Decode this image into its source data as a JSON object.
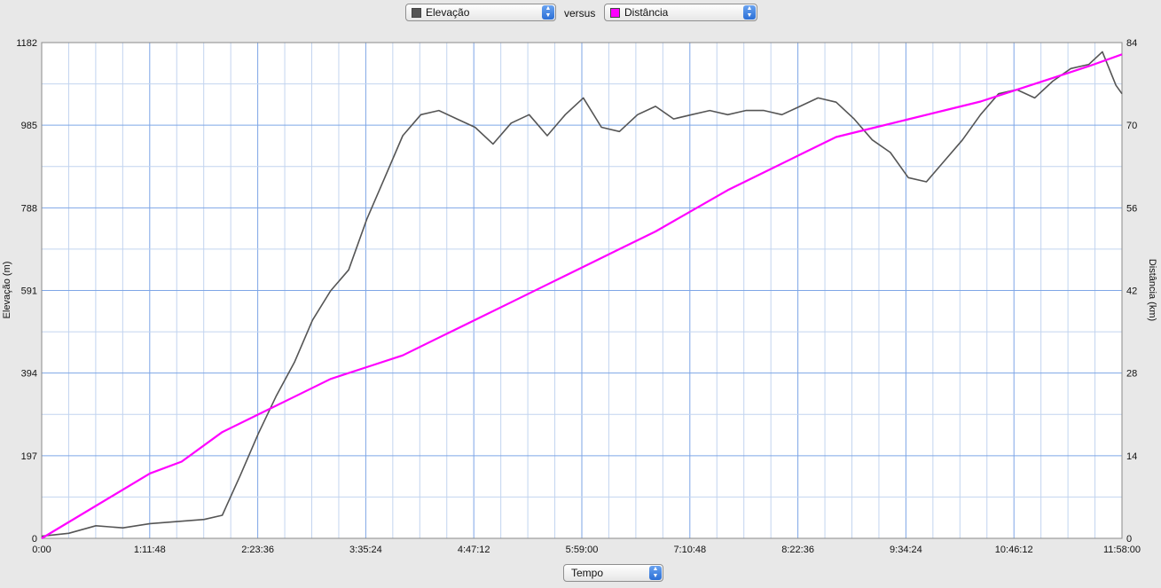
{
  "controls": {
    "series1_select": {
      "value": "Elevação",
      "color": "#555555"
    },
    "versus_label": "versus",
    "series2_select": {
      "value": "Distância",
      "color": "#ff00ff"
    },
    "xaxis_select": {
      "value": "Tempo"
    }
  },
  "chart_data": {
    "type": "line",
    "title": "",
    "xlabel": "Tempo",
    "ylabel_left": "Elevação (m)",
    "ylabel_right": "Distância (km)",
    "x_range_hours": [
      0,
      11.9667
    ],
    "x_tick_labels": [
      "0:00",
      "1:11:48",
      "2:23:36",
      "3:35:24",
      "4:47:12",
      "5:59:00",
      "7:10:48",
      "8:22:36",
      "9:34:24",
      "10:46:12",
      "11:58:00"
    ],
    "y_left_ticks": [
      "0",
      "197",
      "394",
      "591",
      "788",
      "985",
      "1182"
    ],
    "y_left_range": [
      0,
      1182
    ],
    "y_right_ticks": [
      "0",
      "14",
      "28",
      "42",
      "56",
      "70",
      "84"
    ],
    "y_right_range": [
      0,
      84
    ],
    "grid": true,
    "series": [
      {
        "name": "Elevação",
        "axis": "left",
        "color": "#555555",
        "points": [
          [
            0,
            5
          ],
          [
            0.3,
            12
          ],
          [
            0.6,
            30
          ],
          [
            0.9,
            25
          ],
          [
            1.2,
            35
          ],
          [
            1.5,
            40
          ],
          [
            1.8,
            45
          ],
          [
            2.0,
            55
          ],
          [
            2.2,
            150
          ],
          [
            2.4,
            250
          ],
          [
            2.6,
            340
          ],
          [
            2.8,
            420
          ],
          [
            3.0,
            520
          ],
          [
            3.2,
            590
          ],
          [
            3.4,
            640
          ],
          [
            3.6,
            760
          ],
          [
            3.8,
            860
          ],
          [
            4.0,
            960
          ],
          [
            4.2,
            1010
          ],
          [
            4.4,
            1020
          ],
          [
            4.6,
            1000
          ],
          [
            4.8,
            980
          ],
          [
            5.0,
            940
          ],
          [
            5.2,
            990
          ],
          [
            5.4,
            1010
          ],
          [
            5.6,
            960
          ],
          [
            5.8,
            1010
          ],
          [
            6.0,
            1050
          ],
          [
            6.2,
            980
          ],
          [
            6.4,
            970
          ],
          [
            6.6,
            1010
          ],
          [
            6.8,
            1030
          ],
          [
            7.0,
            1000
          ],
          [
            7.2,
            1010
          ],
          [
            7.4,
            1020
          ],
          [
            7.6,
            1010
          ],
          [
            7.8,
            1020
          ],
          [
            8.0,
            1020
          ],
          [
            8.2,
            1010
          ],
          [
            8.4,
            1030
          ],
          [
            8.6,
            1050
          ],
          [
            8.8,
            1040
          ],
          [
            9.0,
            1000
          ],
          [
            9.2,
            950
          ],
          [
            9.4,
            920
          ],
          [
            9.6,
            860
          ],
          [
            9.8,
            850
          ],
          [
            10.0,
            900
          ],
          [
            10.2,
            950
          ],
          [
            10.4,
            1010
          ],
          [
            10.6,
            1060
          ],
          [
            10.8,
            1070
          ],
          [
            11.0,
            1050
          ],
          [
            11.2,
            1090
          ],
          [
            11.4,
            1120
          ],
          [
            11.6,
            1130
          ],
          [
            11.75,
            1160
          ],
          [
            11.9,
            1080
          ],
          [
            11.9667,
            1060
          ]
        ]
      },
      {
        "name": "Distância",
        "axis": "right",
        "color": "#ff00ff",
        "points": [
          [
            0,
            0
          ],
          [
            1.2,
            11
          ],
          [
            1.55,
            13
          ],
          [
            2.0,
            18
          ],
          [
            2.4,
            21
          ],
          [
            2.8,
            24
          ],
          [
            3.2,
            27
          ],
          [
            3.6,
            29
          ],
          [
            4.0,
            31
          ],
          [
            4.4,
            34
          ],
          [
            4.8,
            37
          ],
          [
            5.2,
            40
          ],
          [
            5.6,
            43
          ],
          [
            6.0,
            46
          ],
          [
            6.4,
            49
          ],
          [
            6.8,
            52
          ],
          [
            7.2,
            55.5
          ],
          [
            7.6,
            59
          ],
          [
            8.0,
            62
          ],
          [
            8.4,
            65
          ],
          [
            8.8,
            68
          ],
          [
            9.2,
            69.5
          ],
          [
            9.6,
            71
          ],
          [
            10.0,
            72.5
          ],
          [
            10.4,
            74
          ],
          [
            10.8,
            76
          ],
          [
            11.2,
            78
          ],
          [
            11.6,
            80
          ],
          [
            11.9667,
            82
          ]
        ]
      }
    ]
  }
}
